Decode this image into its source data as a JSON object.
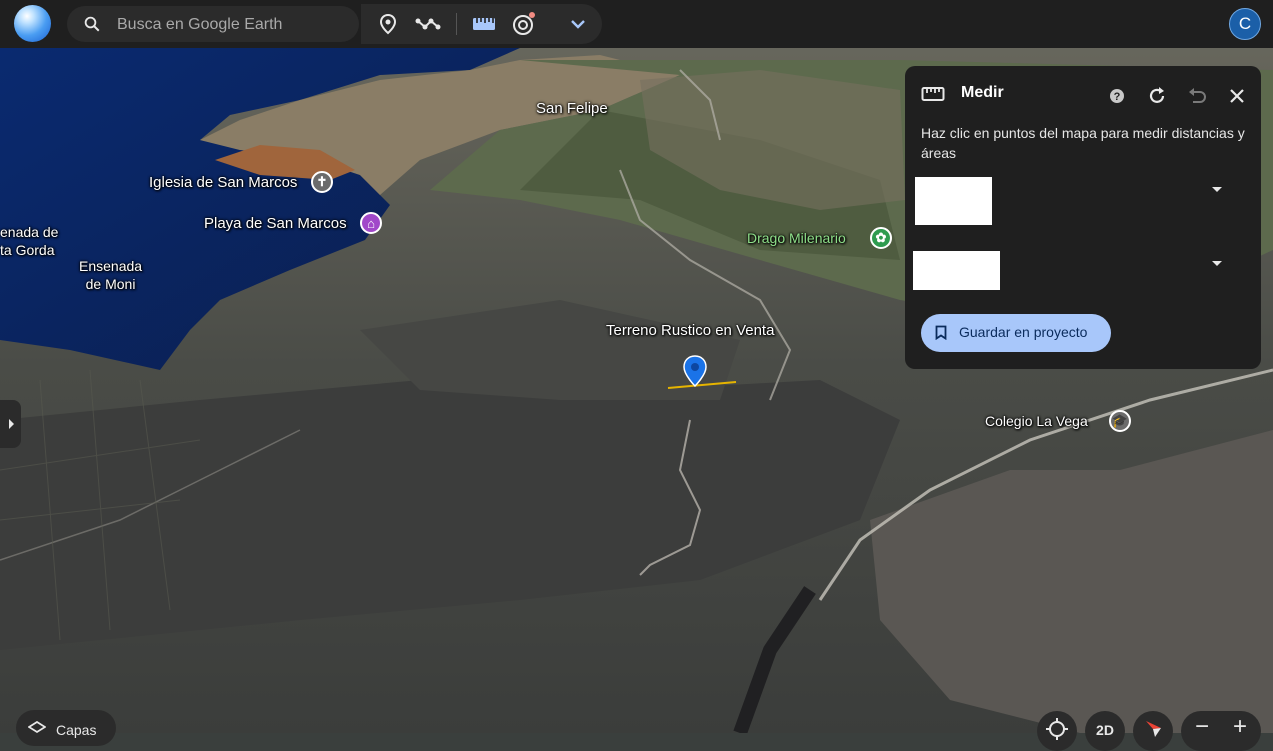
{
  "search": {
    "placeholder": "Busca en Google Earth"
  },
  "account": {
    "initial": "C"
  },
  "map_labels": {
    "san_felipe": "San Felipe",
    "iglesia": "Iglesia de San Marcos",
    "playa": "Playa de San Marcos",
    "ensenada_gorda_1": "enada de",
    "ensenada_gorda_2": "ta Gorda",
    "ensenada_moni_1": "Ensenada",
    "ensenada_moni_2": "de Moni",
    "drago": "Drago Milenario",
    "terreno": "Terreno Rustico en Venta",
    "colegio": "Colegio La Vega"
  },
  "measure_panel": {
    "title": "Medir",
    "hint": "Haz clic en puntos del mapa para medir distancias y áreas",
    "save_label": "Guardar en proyecto"
  },
  "bottom": {
    "layers_label": "Capas",
    "view_mode": "2D",
    "zoom_out": "−",
    "zoom_in": "+"
  },
  "colors": {
    "toolbar_bg": "#1f1f1f",
    "control_bg": "#2b2b2b",
    "accent_button": "#a8c7fa",
    "pin": "#1a73e8",
    "ocean": "#0d2a6b"
  },
  "icons": {
    "search": "search-icon",
    "placemark": "placemark-icon",
    "path": "path-icon",
    "ruler": "ruler-icon",
    "voyager": "voyager-icon",
    "more": "chevron-down-icon",
    "help": "help-icon",
    "reset": "refresh-icon",
    "undo": "undo-icon",
    "close": "close-icon",
    "bookmark": "bookmark-icon",
    "layers": "layers-icon",
    "locate": "my-location-icon",
    "compass": "compass-icon"
  }
}
